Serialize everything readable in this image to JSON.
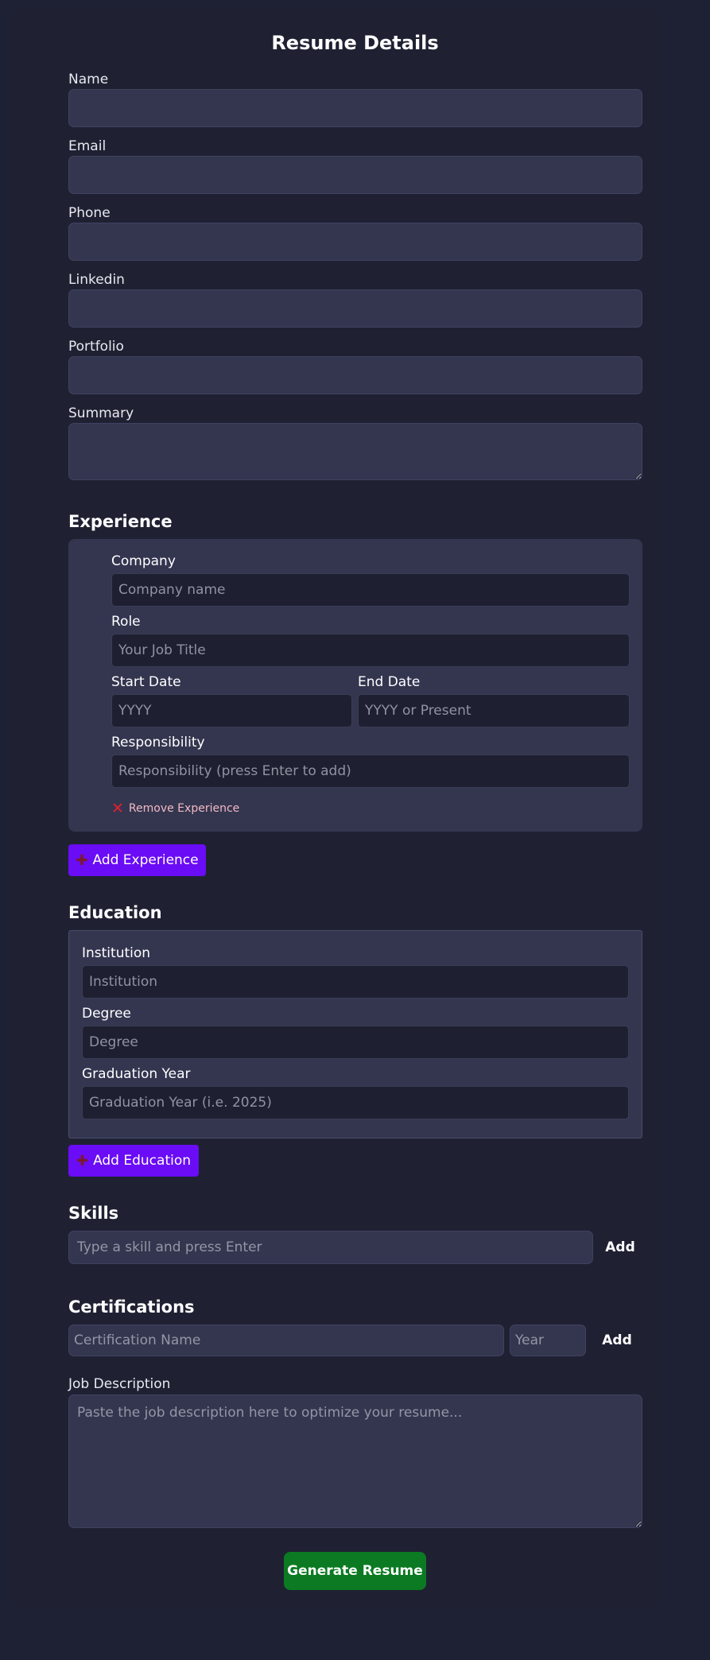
{
  "form": {
    "title": "Resume Details",
    "name_label": "Name",
    "email_label": "Email",
    "phone_label": "Phone",
    "linkedin_label": "Linkedin",
    "portfolio_label": "Portfolio",
    "summary_label": "Summary"
  },
  "experience": {
    "heading": "Experience",
    "company_label": "Company",
    "company_placeholder": "Company name",
    "role_label": "Role",
    "role_placeholder": "Your Job Title",
    "start_label": "Start Date",
    "start_placeholder": "YYYY",
    "end_label": "End Date",
    "end_placeholder": "YYYY or Present",
    "resp_label": "Responsibility",
    "resp_placeholder": "Responsibility (press Enter to add)",
    "remove_label": "Remove Experience",
    "add_label": "Add Experience"
  },
  "education": {
    "heading": "Education",
    "institution_label": "Institution",
    "institution_placeholder": "Institution",
    "degree_label": "Degree",
    "degree_placeholder": "Degree",
    "grad_label": "Graduation Year",
    "grad_placeholder": "Graduation Year (i.e. 2025)",
    "add_label": "Add Education"
  },
  "skills": {
    "heading": "Skills",
    "placeholder": "Type a skill and press Enter",
    "add_label": "Add"
  },
  "certifications": {
    "heading": "Certifications",
    "name_placeholder": "Certification Name",
    "year_placeholder": "Year",
    "add_label": "Add"
  },
  "job": {
    "label": "Job Description",
    "placeholder": "Paste the job description here to optimize your resume..."
  },
  "generate_label": "Generate Resume",
  "icons": {
    "remove": "cross-mark-icon",
    "add": "plus-icon"
  },
  "colors": {
    "background": "#1e2033",
    "field": "#343650",
    "primary_button": "#6a0cf5",
    "generate_button": "#0b7a22",
    "remove_icon": "#e0202e"
  }
}
